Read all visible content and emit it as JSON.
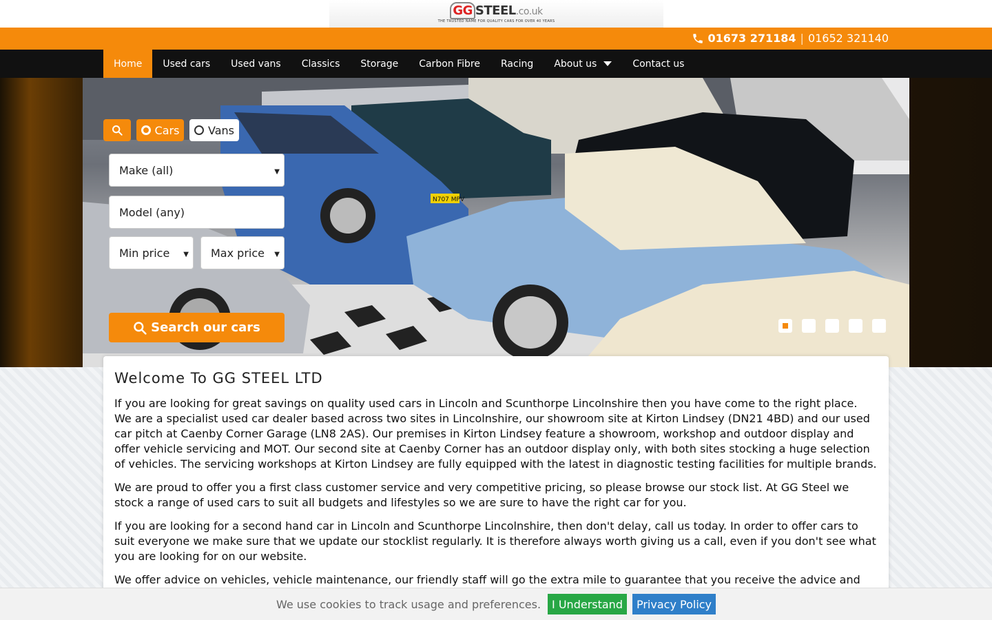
{
  "brand": {
    "logo_main_gg": "GG",
    "logo_main_steel": "STEEL",
    "logo_main_tld": ".co.uk",
    "logo_tagline": "THE TRUSTED NAME FOR QUALITY CARS FOR OVER 40 YEARS"
  },
  "contact": {
    "phone_primary": "01673 271184",
    "separator": "|",
    "phone_secondary": "01652 321140"
  },
  "nav": {
    "items": [
      "Home",
      "Used cars",
      "Used vans",
      "Classics",
      "Storage",
      "Carbon Fibre",
      "Racing",
      "About us",
      "Contact us"
    ],
    "active": "Home"
  },
  "search": {
    "tab_cars": "Cars",
    "tab_vans": "Vans",
    "selected_tab": "Cars",
    "make": "Make (all)",
    "model_placeholder": "Model (any)",
    "min_price": "Min price",
    "max_price": "Max price",
    "button": "Search our cars"
  },
  "slider": {
    "slide_count": 5,
    "active_slide": 1,
    "plates": [
      "N707 MPV"
    ]
  },
  "welcome": {
    "title": "Welcome To GG STEEL LTD",
    "paragraphs": [
      "If you are looking for great savings on quality used cars in Lincoln and Scunthorpe Lincolnshire then you have come to the right place. We are a specialist used car dealer based across two sites in Lincolnshire, our showroom site at Kirton Lindsey (DN21 4BD) and our used car pitch at Caenby Corner Garage (LN8 2AS). Our premises in Kirton Lindsey feature a showroom, workshop and outdoor display and offer vehicle servicing and MOT. Our second site at Caenby Corner has an outdoor display only, with both sites stocking a huge selection of vehicles. The servicing workshops at Kirton Lindsey are fully equipped with the latest in diagnostic testing facilities for multiple brands.",
      "We are proud to offer you a first class customer service and very competitive pricing, so please browse our stock list. At GG Steel we stock a range of used cars to suit all budgets and lifestyles so we are sure to have the right car for you.",
      "If you are looking for a second hand car in Lincoln and Scunthorpe Lincolnshire, then don't delay, call us today. In order to offer cars to suit everyone we make sure that we update our stocklist regularly. It is therefore always worth giving us a call, even if you don't see what you are looking for on our website.",
      "We offer advice on vehicles, vehicle maintenance, our friendly staff will go the extra mile to guarantee that you receive the advice and support you"
    ]
  },
  "cookie": {
    "text": "We use cookies to track usage and preferences.",
    "accept": "I Understand",
    "privacy": "Privacy Policy"
  },
  "colors": {
    "accent": "#f58a0b",
    "nav_bg": "#111111",
    "accept_green": "#28a745",
    "privacy_blue": "#2f7fc9"
  }
}
